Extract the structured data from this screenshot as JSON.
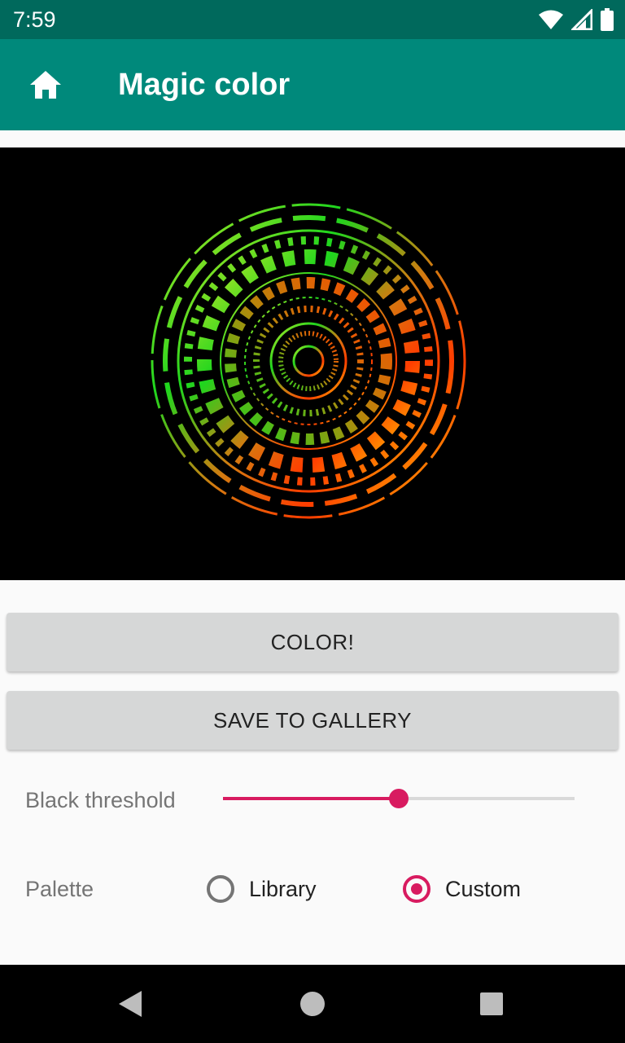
{
  "status_bar": {
    "time": "7:59",
    "icons": [
      "wifi-icon",
      "signal-icon",
      "battery-icon"
    ]
  },
  "app_bar": {
    "home_icon": "home-icon",
    "title": "Magic color"
  },
  "buttons": {
    "color": "COLOR!",
    "save": "SAVE TO GALLERY"
  },
  "threshold": {
    "label": "Black threshold",
    "value": 0.5
  },
  "palette": {
    "label": "Palette",
    "options": [
      {
        "label": "Library",
        "selected": false
      },
      {
        "label": "Custom",
        "selected": true
      }
    ]
  },
  "nav_bar": {
    "icons": [
      "back-icon",
      "home-circle-icon",
      "recents-icon"
    ]
  },
  "colors": {
    "status_bar": "#00695c",
    "app_bar": "#00897b",
    "accent": "#d81b60"
  }
}
